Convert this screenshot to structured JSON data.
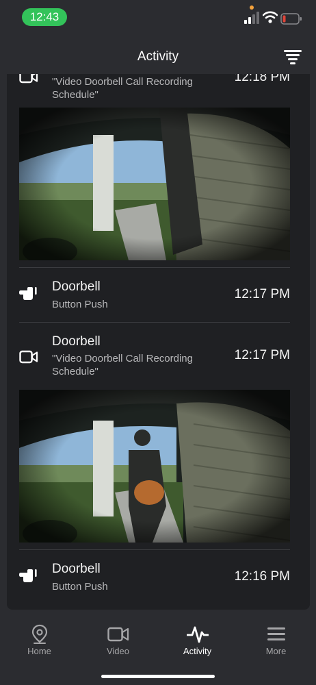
{
  "status_bar": {
    "time": "12:43"
  },
  "header": {
    "title": "Activity"
  },
  "feed": {
    "items": [
      {
        "type": "video",
        "icon": "video-camera-icon",
        "title": "",
        "subtitle": "\"Video Doorbell Call Recording Schedule\"",
        "time": "12:18 PM"
      },
      {
        "type": "push",
        "icon": "doorbell-press-icon",
        "title": "Doorbell",
        "subtitle": "Button Push",
        "time": "12:17 PM"
      },
      {
        "type": "video",
        "icon": "video-camera-icon",
        "title": "Doorbell",
        "subtitle": "\"Video Doorbell Call Recording Schedule\"",
        "time": "12:17 PM"
      },
      {
        "type": "push",
        "icon": "doorbell-press-icon",
        "title": "Doorbell",
        "subtitle": "Button Push",
        "time": "12:16 PM"
      }
    ]
  },
  "tabs": [
    {
      "label": "Home",
      "icon": "map-pin-icon",
      "active": false
    },
    {
      "label": "Video",
      "icon": "video-camera-icon",
      "active": false
    },
    {
      "label": "Activity",
      "icon": "activity-pulse-icon",
      "active": true
    },
    {
      "label": "More",
      "icon": "hamburger-menu-icon",
      "active": false
    }
  ],
  "colors": {
    "accent_green": "#33c35a",
    "battery_low": "#e0453a",
    "background": "#2b2c30",
    "card": "#1f2023"
  }
}
